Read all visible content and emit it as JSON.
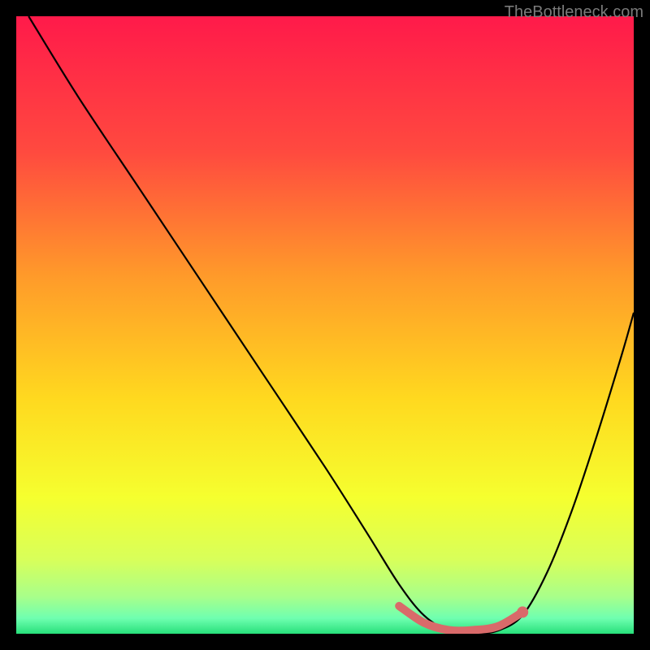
{
  "watermark": "TheBottleneck.com",
  "chart_data": {
    "type": "line",
    "title": "",
    "xlabel": "",
    "ylabel": "",
    "xlim": [
      0,
      100
    ],
    "ylim": [
      0,
      100
    ],
    "series": [
      {
        "name": "bottleneck-curve",
        "x": [
          2,
          10,
          20,
          30,
          40,
          50,
          57,
          62,
          66,
          70,
          74,
          78,
          82,
          86,
          90,
          94,
          98,
          100
        ],
        "y": [
          100,
          87,
          72,
          57,
          42,
          27,
          16,
          8,
          3,
          0.5,
          0,
          0.5,
          3,
          10,
          20,
          32,
          45,
          52
        ]
      },
      {
        "name": "highlight-segment",
        "x": [
          62,
          66,
          70,
          74,
          78,
          82
        ],
        "y": [
          4.5,
          1.8,
          0.6,
          0.6,
          1.2,
          3.5
        ]
      }
    ],
    "highlight_point": {
      "x": 82,
      "y": 3.5
    },
    "gradient_stops": [
      {
        "offset": 0,
        "color": "#ff1a4a"
      },
      {
        "offset": 0.22,
        "color": "#ff4a3f"
      },
      {
        "offset": 0.42,
        "color": "#ff9a2a"
      },
      {
        "offset": 0.62,
        "color": "#ffd91f"
      },
      {
        "offset": 0.78,
        "color": "#f5ff2f"
      },
      {
        "offset": 0.88,
        "color": "#d8ff5a"
      },
      {
        "offset": 0.94,
        "color": "#a8ff8a"
      },
      {
        "offset": 0.975,
        "color": "#6fffb0"
      },
      {
        "offset": 1.0,
        "color": "#27e07a"
      }
    ]
  }
}
